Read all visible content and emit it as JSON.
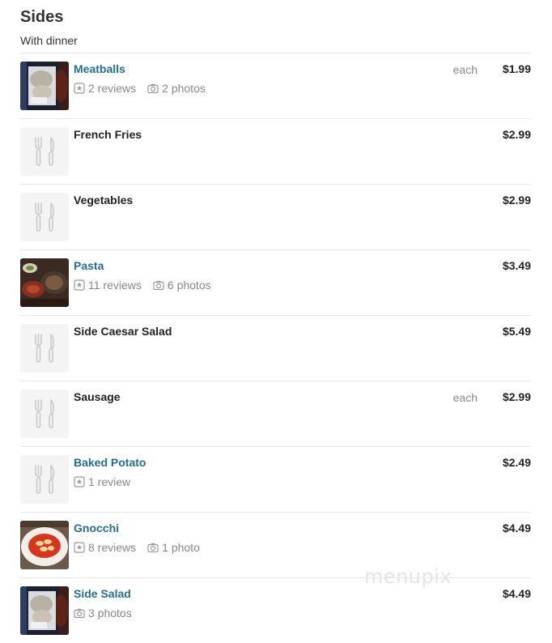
{
  "section": {
    "title": "Sides",
    "subtitle": "With dinner"
  },
  "items": [
    {
      "name": "Meatballs",
      "unit": "each",
      "price": "$1.99",
      "reviews": "2 reviews",
      "photos": "2 photos",
      "linked": true,
      "thumb": "photo-plate"
    },
    {
      "name": "French Fries",
      "unit": "",
      "price": "$2.99",
      "reviews": "",
      "photos": "",
      "linked": false,
      "thumb": "fork-knife-placeholder-icon"
    },
    {
      "name": "Vegetables",
      "unit": "",
      "price": "$2.99",
      "reviews": "",
      "photos": "",
      "linked": false,
      "thumb": "fork-knife-placeholder-icon"
    },
    {
      "name": "Pasta",
      "unit": "",
      "price": "$3.49",
      "reviews": "11 reviews",
      "photos": "6 photos",
      "linked": true,
      "thumb": "photo-table"
    },
    {
      "name": "Side Caesar Salad",
      "unit": "",
      "price": "$5.49",
      "reviews": "",
      "photos": "",
      "linked": false,
      "thumb": "fork-knife-placeholder-icon"
    },
    {
      "name": "Sausage",
      "unit": "each",
      "price": "$2.99",
      "reviews": "",
      "photos": "",
      "linked": false,
      "thumb": "fork-knife-placeholder-icon"
    },
    {
      "name": "Baked Potato",
      "unit": "",
      "price": "$2.49",
      "reviews": "1 review",
      "photos": "",
      "linked": true,
      "thumb": "fork-knife-placeholder-icon"
    },
    {
      "name": "Gnocchi",
      "unit": "",
      "price": "$4.49",
      "reviews": "8 reviews",
      "photos": "1 photo",
      "linked": true,
      "thumb": "photo-gnocchi"
    },
    {
      "name": "Side Salad",
      "unit": "",
      "price": "$4.49",
      "reviews": "",
      "photos": "3 photos",
      "linked": true,
      "thumb": "photo-plate"
    }
  ],
  "watermark": "menupix",
  "colors": {
    "link": "#236e94",
    "text": "#222222",
    "muted": "#888888",
    "divider": "#e6e6e6",
    "placeholder": "#f4f4f4"
  }
}
